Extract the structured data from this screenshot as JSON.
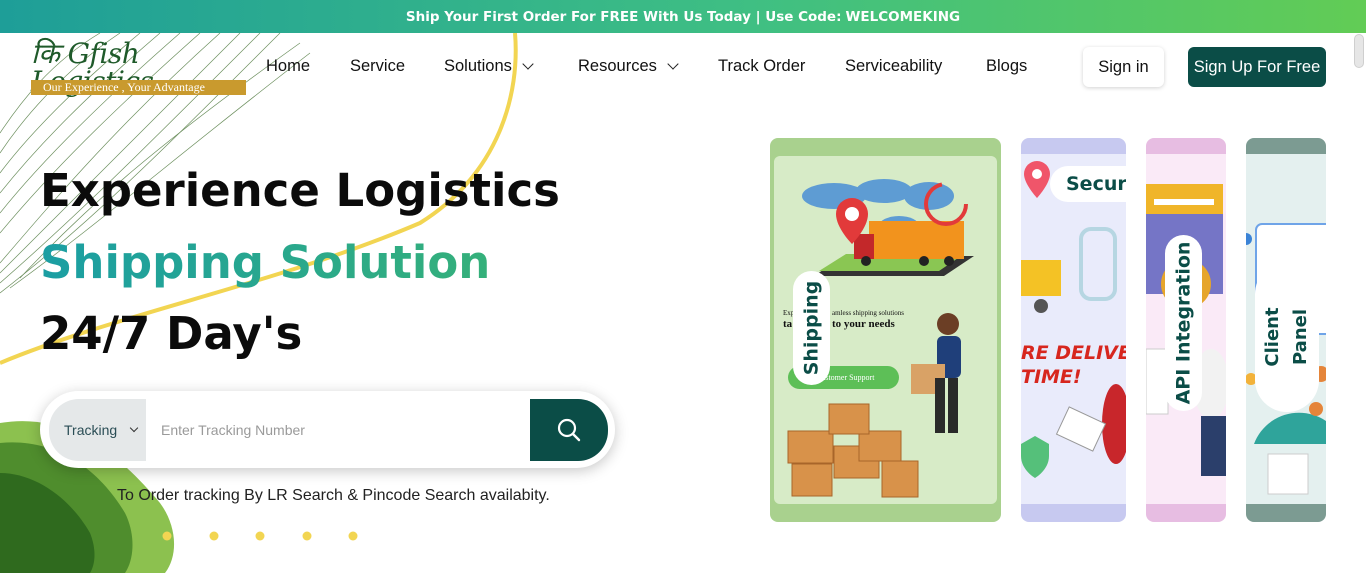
{
  "banner": {
    "text": "Ship Your First Order For FREE With Us Today | Use Code:",
    "code": "WELCOMEKING"
  },
  "logo": {
    "text": "कि Gfish Logistics",
    "tagline": "Our Experience , Your Advantage"
  },
  "nav": {
    "items": [
      {
        "label": "Home",
        "has_dropdown": false
      },
      {
        "label": "Service",
        "has_dropdown": false
      },
      {
        "label": "Solutions",
        "has_dropdown": true
      },
      {
        "label": "Resources",
        "has_dropdown": true
      },
      {
        "label": "Track Order",
        "has_dropdown": false
      },
      {
        "label": "Serviceability",
        "has_dropdown": false
      },
      {
        "label": "Blogs",
        "has_dropdown": false
      }
    ],
    "signin_label": "Sign in",
    "signup_label": "Sign Up For Free"
  },
  "hero": {
    "line1": "Experience Logistics",
    "line2": "Shipping Solution",
    "line3": "24/7 Day's"
  },
  "search": {
    "select_value": "Tracking",
    "placeholder": "Enter Tracking Number",
    "button_icon": "search-icon"
  },
  "hint": "To Order tracking By LR Search & Pincode Search availabity.",
  "cards": [
    {
      "label": "Shipping",
      "text1": "Exp",
      "text2": "amless shipping solutions",
      "text3": "ta",
      "text4": "to your needs",
      "button": "Customer Support"
    },
    {
      "label": "Secure",
      "red_line1": "RE DELIVERY",
      "red_line2": "TIME!"
    },
    {
      "label": "API Integration"
    },
    {
      "label": "Client Panel"
    }
  ],
  "colors": {
    "brand_dark": "#0b4d47",
    "accent_teal": "#1fa48f",
    "banner_start": "#1e9e98",
    "banner_end": "#62cc55"
  }
}
